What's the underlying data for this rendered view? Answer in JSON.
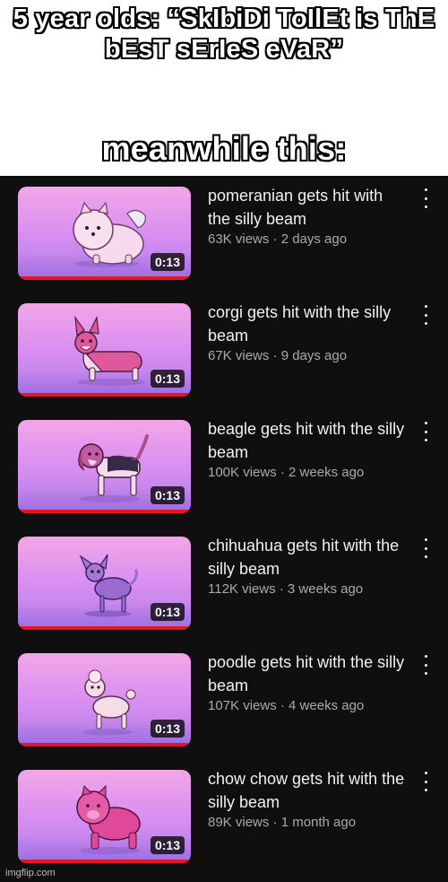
{
  "meme": {
    "top_caption": "5 year olds: “SkIbiDi ToIlEt is ThE bEsT sErIeS eVaR”",
    "middle_caption": "meanwhile this:"
  },
  "videos": [
    {
      "title": "pomeranian gets hit with the silly beam",
      "meta": "63K views · 2 days ago",
      "duration": "0:13",
      "thumbnail_icon": "pomeranian-icon"
    },
    {
      "title": "corgi gets hit with the silly beam",
      "meta": "67K views · 9 days ago",
      "duration": "0:13",
      "thumbnail_icon": "corgi-icon"
    },
    {
      "title": "beagle gets hit with the silly beam",
      "meta": "100K views · 2 weeks ago",
      "duration": "0:13",
      "thumbnail_icon": "beagle-icon"
    },
    {
      "title": "chihuahua gets hit with the silly beam",
      "meta": "112K views · 3 weeks ago",
      "duration": "0:13",
      "thumbnail_icon": "chihuahua-icon"
    },
    {
      "title": "poodle gets hit with the silly beam",
      "meta": "107K views · 4 weeks ago",
      "duration": "0:13",
      "thumbnail_icon": "poodle-icon"
    },
    {
      "title": "chow chow gets hit with the silly beam",
      "meta": "89K views · 1 month ago",
      "duration": "0:13",
      "thumbnail_icon": "chow-chow-icon"
    }
  ],
  "watermark": "imgflip.com",
  "colors": {
    "panel_background": "#0f0f0f",
    "progress_bar": "#e5161f",
    "thumbnail_gradient_top": "#f2a6e8",
    "thumbnail_gradient_bottom": "#b27de8"
  }
}
